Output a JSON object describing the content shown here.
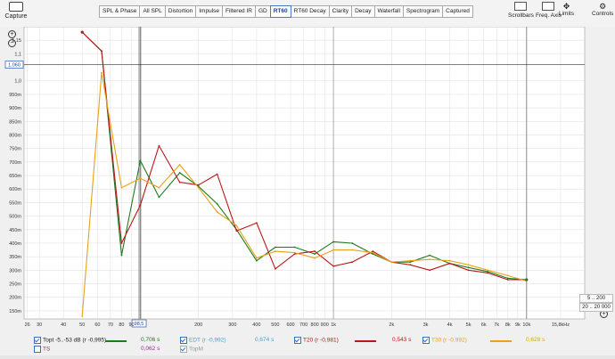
{
  "toolbar": {
    "capture_label": "Capture",
    "tabs": [
      "SPL & Phase",
      "All SPL",
      "Distortion",
      "Impulse",
      "Filtered IR",
      "GD",
      "RT60",
      "RT60 Decay",
      "Clarity",
      "Decay",
      "Waterfall",
      "Spectrogram",
      "Captured"
    ],
    "active_tab": "RT60",
    "scrollbars_label": "Scrollbars",
    "freq_axis_label": "Freq. Axis",
    "limits_label": "Limits",
    "controls_label": "Controls"
  },
  "ranges": {
    "r1": "5 .. 200",
    "r2": "20 .. 20 000"
  },
  "cursor_readout": {
    "y": "1,060",
    "x": "98,5"
  },
  "legend": {
    "topt": {
      "label": "Topt -5..-53 dB (r -0,995)",
      "value": "0,706 s"
    },
    "edt": {
      "label": "EDT (r -0,992)",
      "value": "0,674 s"
    },
    "t20": {
      "label": "T20 (r -0,981)",
      "value": "0,543 s"
    },
    "t30": {
      "label": "T30 (r -0,992)",
      "value": "0,628 s"
    },
    "ts": {
      "label": "TS",
      "value": "0,062 s"
    },
    "topm": {
      "label": "TopM"
    }
  },
  "chart_data": {
    "type": "line",
    "x_scale": "log",
    "xlim": [
      25,
      20000
    ],
    "ylim": [
      0.12,
      1.2
    ],
    "grid": true,
    "legend": "bottom",
    "x_ticks": [
      {
        "v": 26,
        "l": "26"
      },
      {
        "v": 30,
        "l": "30"
      },
      {
        "v": 40,
        "l": "40"
      },
      {
        "v": 50,
        "l": "50"
      },
      {
        "v": 60,
        "l": "60"
      },
      {
        "v": 70,
        "l": "70"
      },
      {
        "v": 80,
        "l": "80"
      },
      {
        "v": 90,
        "l": "90"
      },
      {
        "v": 200,
        "l": "200"
      },
      {
        "v": 300,
        "l": "300"
      },
      {
        "v": 400,
        "l": "400"
      },
      {
        "v": 500,
        "l": "500"
      },
      {
        "v": 600,
        "l": "600"
      },
      {
        "v": 700,
        "l": "700"
      },
      {
        "v": 800,
        "l": "800"
      },
      {
        "v": 900,
        "l": "900"
      },
      {
        "v": 1000,
        "l": "1k"
      },
      {
        "v": 2000,
        "l": "2k"
      },
      {
        "v": 3000,
        "l": "3k"
      },
      {
        "v": 4000,
        "l": "4k"
      },
      {
        "v": 5000,
        "l": "5k"
      },
      {
        "v": 6000,
        "l": "6k"
      },
      {
        "v": 7000,
        "l": "7k"
      },
      {
        "v": 8000,
        "l": "8k"
      },
      {
        "v": 9000,
        "l": "9k"
      },
      {
        "v": 10000,
        "l": "10k"
      },
      {
        "v": 15000,
        "l": "15,8kHz"
      }
    ],
    "y_ticks": [
      {
        "v": 1.15,
        "l": "1,15"
      },
      {
        "v": 1.1,
        "l": "1,1"
      },
      {
        "v": 1.0,
        "l": "1,0"
      },
      {
        "v": 0.95,
        "l": "950m"
      },
      {
        "v": 0.9,
        "l": "900m"
      },
      {
        "v": 0.85,
        "l": "850m"
      },
      {
        "v": 0.8,
        "l": "800m"
      },
      {
        "v": 0.75,
        "l": "750m"
      },
      {
        "v": 0.7,
        "l": "700m"
      },
      {
        "v": 0.65,
        "l": "650m"
      },
      {
        "v": 0.6,
        "l": "600m"
      },
      {
        "v": 0.55,
        "l": "550m"
      },
      {
        "v": 0.5,
        "l": "500m"
      },
      {
        "v": 0.45,
        "l": "450m"
      },
      {
        "v": 0.4,
        "l": "400m"
      },
      {
        "v": 0.35,
        "l": "350m"
      },
      {
        "v": 0.3,
        "l": "300m"
      },
      {
        "v": 0.25,
        "l": "250m"
      },
      {
        "v": 0.2,
        "l": "200m"
      },
      {
        "v": 0.15,
        "l": "150m"
      }
    ],
    "series": [
      {
        "key": "topt",
        "color": "#1e7a1e",
        "x": [
          50,
          63,
          80,
          100,
          125,
          160,
          200,
          250,
          315,
          400,
          500,
          630,
          800,
          1000,
          1250,
          1600,
          2000,
          2500,
          3150,
          4000,
          5000,
          6300,
          8000,
          10000
        ],
        "y": [
          1.18,
          1.11,
          0.355,
          0.705,
          0.57,
          0.66,
          0.61,
          0.545,
          0.45,
          0.335,
          0.385,
          0.385,
          0.36,
          0.405,
          0.4,
          0.36,
          0.33,
          0.33,
          0.355,
          0.325,
          0.31,
          0.295,
          0.27,
          0.265
        ]
      },
      {
        "key": "t20",
        "color": "#b81818",
        "x": [
          50,
          63,
          80,
          100,
          125,
          160,
          200,
          250,
          315,
          400,
          500,
          630,
          800,
          1000,
          1250,
          1600,
          2000,
          2500,
          3150,
          4000,
          5000,
          6300,
          8000,
          10000
        ],
        "y": [
          1.18,
          1.11,
          0.4,
          0.54,
          0.76,
          0.625,
          0.615,
          0.655,
          0.445,
          0.475,
          0.305,
          0.36,
          0.37,
          0.315,
          0.33,
          0.37,
          0.33,
          0.32,
          0.3,
          0.325,
          0.3,
          0.29,
          0.265,
          0.265
        ]
      },
      {
        "key": "t30",
        "color": "#e8a11a",
        "x": [
          50,
          63,
          80,
          100,
          125,
          160,
          200,
          250,
          315,
          400,
          500,
          630,
          800,
          1000,
          1250,
          1600,
          2000,
          2500,
          3150,
          4000,
          5000,
          6300,
          8000,
          10000
        ],
        "y": [
          0.13,
          1.03,
          0.605,
          0.64,
          0.605,
          0.69,
          0.605,
          0.515,
          0.465,
          0.345,
          0.37,
          0.365,
          0.345,
          0.375,
          0.375,
          0.365,
          0.33,
          0.335,
          0.34,
          0.335,
          0.32,
          0.3,
          0.28,
          0.26
        ]
      }
    ]
  }
}
